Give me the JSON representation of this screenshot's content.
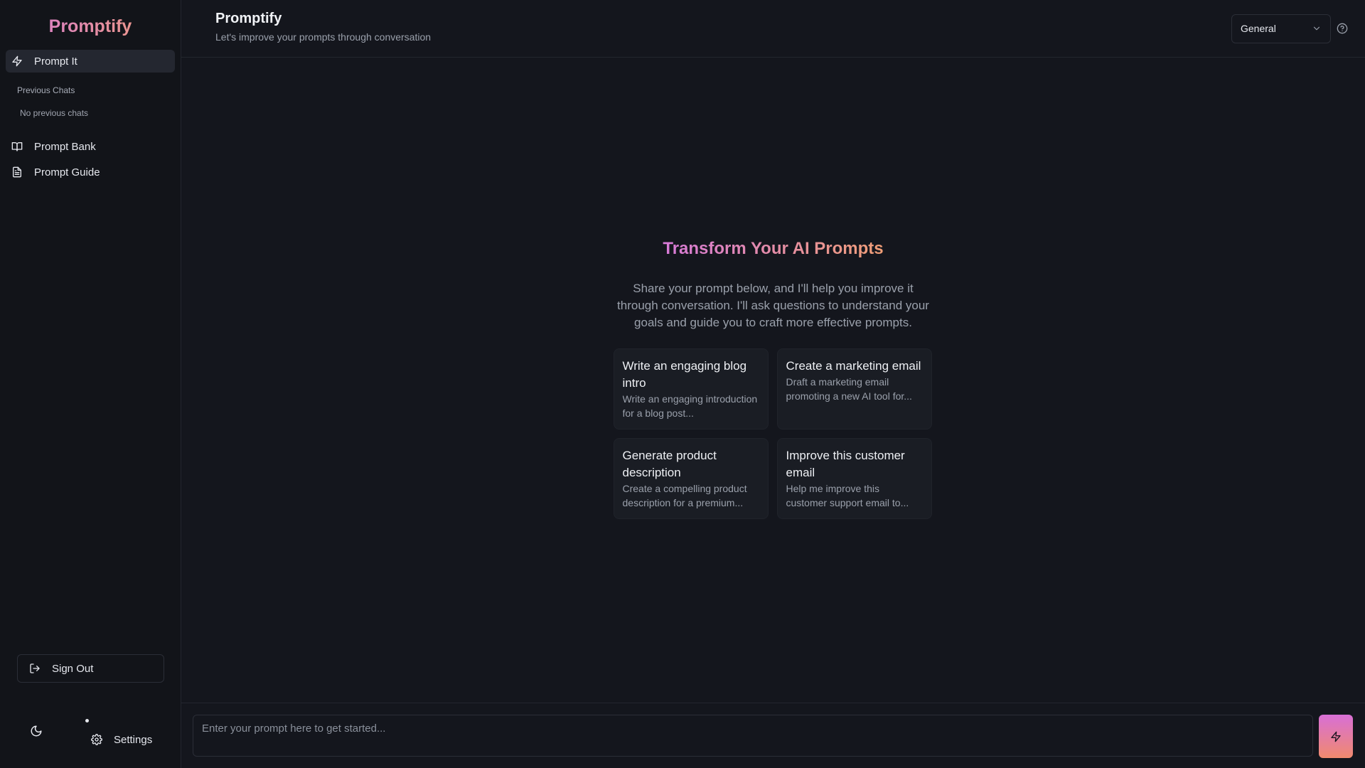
{
  "app": {
    "brand": "Promptify"
  },
  "sidebar": {
    "primary_item": {
      "label": "Prompt It",
      "icon": "zap-icon"
    },
    "previous_chats_label": "Previous Chats",
    "no_chats_text": "No previous chats",
    "items": [
      {
        "label": "Prompt Bank",
        "icon": "book-open-icon"
      },
      {
        "label": "Prompt Guide",
        "icon": "file-text-icon"
      }
    ],
    "sign_out_label": "Sign Out",
    "settings_label": "Settings"
  },
  "header": {
    "title": "Promptify",
    "subtitle": "Let's improve your prompts through conversation",
    "mode_select": {
      "selected": "General"
    }
  },
  "hero": {
    "title": "Transform Your AI Prompts",
    "description": "Share your prompt below, and I'll help you improve it through conversation. I'll ask questions to understand your goals and guide you to craft more effective prompts."
  },
  "suggestions": [
    {
      "title": "Write an engaging blog intro",
      "text": "Write an engaging introduction for a blog post..."
    },
    {
      "title": "Create a marketing email",
      "text": "Draft a marketing email promoting a new AI tool for..."
    },
    {
      "title": "Generate product description",
      "text": "Create a compelling product description for a premium..."
    },
    {
      "title": "Improve this customer email",
      "text": "Help me improve this customer support email to..."
    }
  ],
  "composer": {
    "placeholder": "Enter your prompt here to get started..."
  },
  "colors": {
    "accent_start": "#d77ad9",
    "accent_end": "#f09e76",
    "background": "#14161d",
    "sidebar": "#121419"
  }
}
